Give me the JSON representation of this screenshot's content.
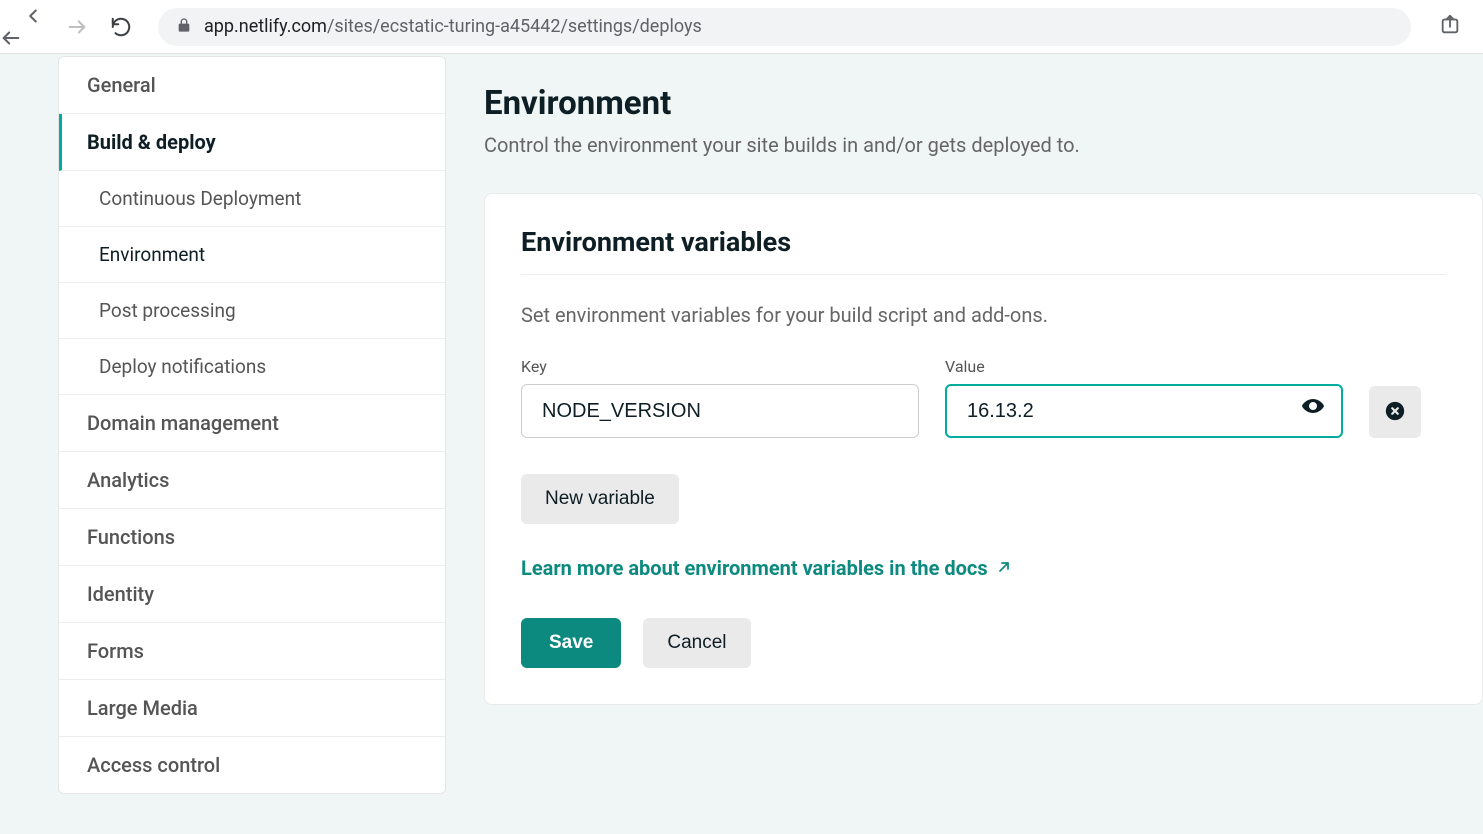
{
  "browser": {
    "url_host_prefix": "app.netlify.com",
    "url_path": "/sites/ecstatic-turing-a45442/settings/deploys"
  },
  "sidebar": {
    "items": [
      {
        "label": "General"
      },
      {
        "label": "Build & deploy"
      },
      {
        "label": "Continuous Deployment"
      },
      {
        "label": "Environment"
      },
      {
        "label": "Post processing"
      },
      {
        "label": "Deploy notifications"
      },
      {
        "label": "Domain management"
      },
      {
        "label": "Analytics"
      },
      {
        "label": "Functions"
      },
      {
        "label": "Identity"
      },
      {
        "label": "Forms"
      },
      {
        "label": "Large Media"
      },
      {
        "label": "Access control"
      }
    ]
  },
  "page": {
    "title": "Environment",
    "subtitle": "Control the environment your site builds in and/or gets deployed to."
  },
  "card": {
    "title": "Environment variables",
    "description": "Set environment variables for your build script and add-ons.",
    "key_label": "Key",
    "value_label": "Value",
    "new_variable_btn": "New variable",
    "docs_link": "Learn more about environment variables in the docs",
    "save_btn": "Save",
    "cancel_btn": "Cancel"
  },
  "env_var": {
    "key": "NODE_VERSION",
    "value": "16.13.2"
  },
  "colors": {
    "teal": "#00ad9f",
    "teal_dark": "#0d8a7f"
  }
}
